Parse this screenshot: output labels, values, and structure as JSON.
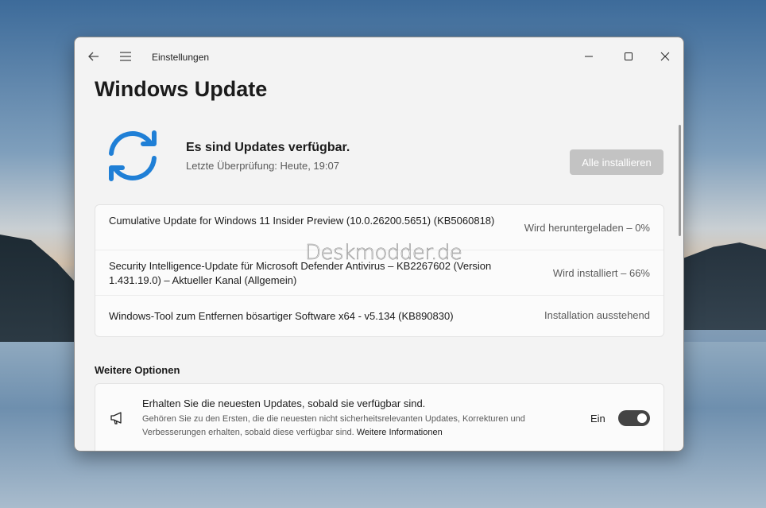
{
  "window": {
    "app_title": "Einstellungen",
    "page_title": "Windows Update"
  },
  "status": {
    "headline": "Es sind Updates verfügbar.",
    "last_check": "Letzte Überprüfung: Heute, 19:07",
    "install_button": "Alle installieren"
  },
  "updates": [
    {
      "name": "Cumulative Update for Windows 11 Insider Preview (10.0.26200.5651) (KB5060818)",
      "status": "Wird heruntergeladen – 0%"
    },
    {
      "name": "Security Intelligence-Update für Microsoft Defender Antivirus – KB2267602 (Version 1.431.19.0) – Aktueller Kanal (Allgemein)",
      "status": "Wird installiert – 66%"
    },
    {
      "name": "Windows-Tool zum Entfernen bösartiger Software x64 - v5.134 (KB890830)",
      "status": "Installation ausstehend"
    }
  ],
  "more_options": {
    "section_title": "Weitere Optionen",
    "early_updates": {
      "title": "Erhalten Sie die neuesten Updates, sobald sie verfügbar sind.",
      "description": "Gehören Sie zu den Ersten, die die neuesten nicht sicherheitsrelevanten Updates, Korrekturen und Verbesserungen erhalten, sobald diese verfügbar sind.",
      "link": "Weitere Informationen",
      "toggle_label": "Ein",
      "toggle_on": true
    }
  },
  "watermark": "Deskmodder.de",
  "icons": {
    "back": "back-arrow-icon",
    "menu": "hamburger-icon",
    "sync": "sync-icon",
    "megaphone": "megaphone-icon"
  },
  "colors": {
    "accent": "#1f7fd6",
    "toggle_on": "#444444",
    "disabled_button": "#c3c3c3"
  }
}
